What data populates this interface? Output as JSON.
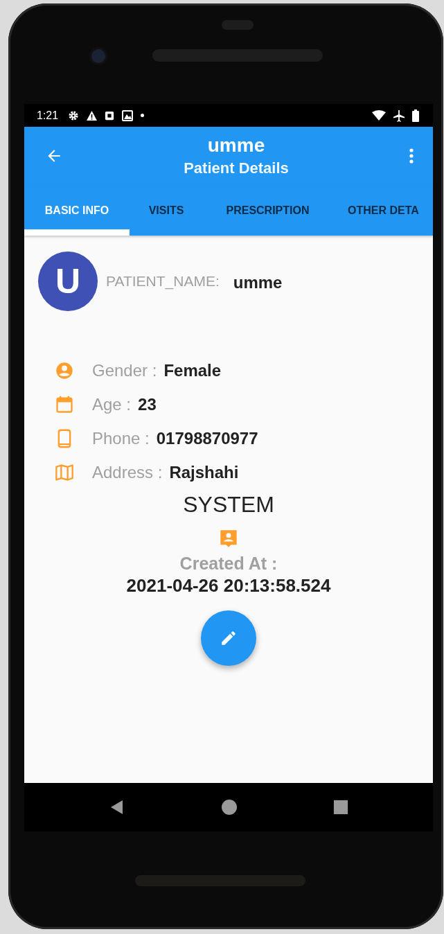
{
  "status_bar": {
    "time": "1:21"
  },
  "app_bar": {
    "title": "umme",
    "subtitle": "Patient Details"
  },
  "tabs": [
    {
      "label": "BASIC INFO",
      "selected": true
    },
    {
      "label": "VISITS",
      "selected": false
    },
    {
      "label": "PRESCRIPTION",
      "selected": false
    },
    {
      "label": "OTHER DETA",
      "selected": false
    }
  ],
  "patient": {
    "avatar_letter": "U",
    "name_label": "PATIENT_NAME:",
    "name": "umme"
  },
  "details": [
    {
      "kind": "person",
      "label": "Gender :",
      "value": "Female"
    },
    {
      "kind": "calendar",
      "label": "Age :",
      "value": "23"
    },
    {
      "kind": "phone",
      "label": "Phone :",
      "value": "01798870977"
    },
    {
      "kind": "map",
      "label": "Address :",
      "value": "Rajshahi"
    }
  ],
  "created_by": "SYSTEM",
  "created_at": {
    "label": "Created At :",
    "value": "2021-04-26 20:13:58.524"
  }
}
